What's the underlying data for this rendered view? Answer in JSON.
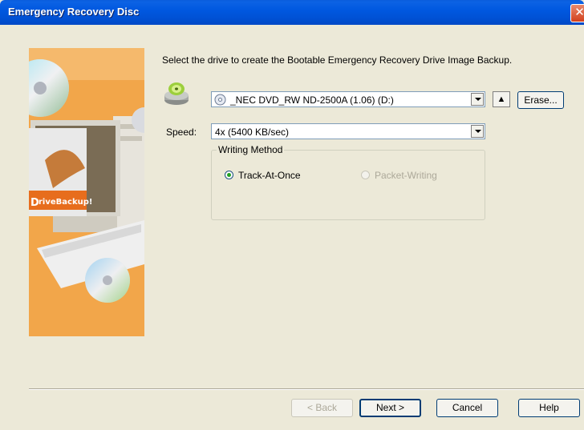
{
  "window": {
    "title": "Emergency Recovery Disc"
  },
  "instruction": "Select the drive to create the Bootable Emergency Recovery Drive Image Backup.",
  "drive": {
    "selected": "_NEC DVD_RW ND-2500A (1.06) (D:)",
    "eject_label": "▲",
    "erase_label": "Erase..."
  },
  "speed": {
    "label": "Speed:",
    "selected": "4x (5400 KB/sec)"
  },
  "writing_method": {
    "legend": "Writing Method",
    "options": [
      {
        "label": "Track-At-Once",
        "selected": true
      },
      {
        "label": "Packet-Writing",
        "selected": false
      }
    ]
  },
  "brand": {
    "logo_text": "DriveBackup!"
  },
  "buttons": {
    "back": "< Back",
    "next": "Next >",
    "cancel": "Cancel",
    "help": "Help"
  },
  "colors": {
    "titlebar": "#0054e3",
    "dialog_bg": "#ece9d8",
    "side_image": "#f3a23a"
  }
}
